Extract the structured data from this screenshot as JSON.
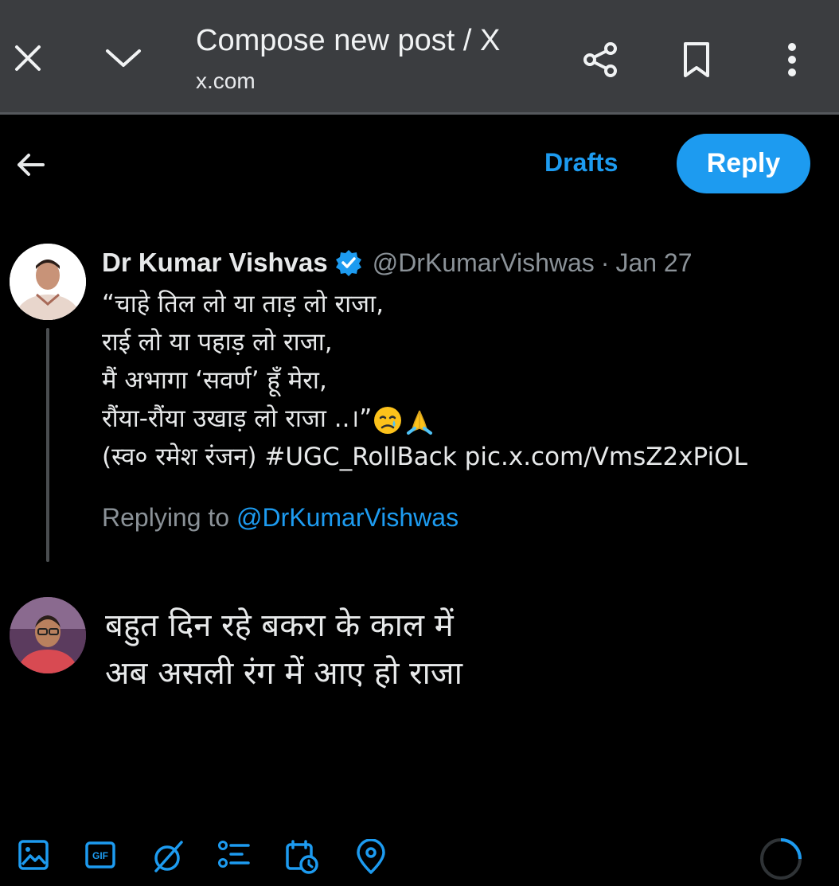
{
  "browser": {
    "title": "Compose new post / X",
    "url": "x.com",
    "icons": [
      "close-icon",
      "chevron-down-icon",
      "share-icon",
      "bookmark-icon",
      "more-vertical-icon"
    ]
  },
  "header": {
    "drafts_label": "Drafts",
    "reply_label": "Reply"
  },
  "original_post": {
    "author_name": "Dr Kumar Vishvas",
    "handle": "@DrKumarVishwas",
    "separator": "·",
    "date": "Jan 27",
    "lines": [
      "“चाहे तिल लो या ताड़ लो राजा,",
      "राई लो या पहाड़ लो राजा,",
      "मैं अभागा ‘सवर्ण’ हूँ मेरा,",
      "रौंया-रौंया उखाड़ लो राजा ..।”"
    ],
    "emojis": [
      "crying-face-icon",
      "folded-hands-icon"
    ],
    "credit": "(स्व० रमेश रंजन)",
    "hashtag": "#UGC_RollBack",
    "link": "pic.x.com/VmsZ2xPiOL",
    "replying_prefix": "Replying to",
    "replying_mention": "@DrKumarVishwas"
  },
  "composer": {
    "lines": [
      "बहुत दिन रहे बकरा के काल में",
      "अब असली रंग में आए हो राजा"
    ]
  },
  "toolbar": {
    "icons": [
      "media-icon",
      "gif-icon",
      "grok-icon",
      "poll-icon",
      "schedule-icon",
      "location-icon"
    ],
    "accent": "#1d9bf0"
  }
}
